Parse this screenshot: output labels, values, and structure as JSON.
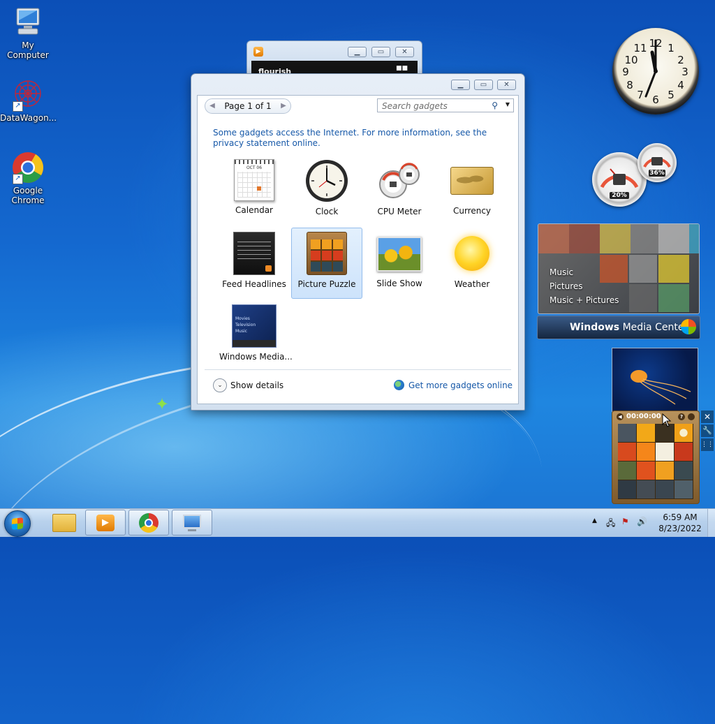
{
  "desktop": {
    "icons": [
      {
        "label": "My Computer",
        "icon": "computer-icon"
      },
      {
        "label": "DataWagon...",
        "icon": "datawagon-icon"
      },
      {
        "label": "Google Chrome",
        "icon": "chrome-icon"
      }
    ]
  },
  "flourish_window": {
    "title": "",
    "content_text": "flourish"
  },
  "gallery": {
    "pager_label": "Page 1 of 1",
    "search_placeholder": "Search gadgets",
    "info_text": "Some gadgets access the Internet.  For more information, see the privacy statement online.",
    "gadgets": [
      {
        "name": "Calendar",
        "icon": "calendar-icon"
      },
      {
        "name": "Clock",
        "icon": "clock-icon"
      },
      {
        "name": "CPU Meter",
        "icon": "cpu-meter-icon"
      },
      {
        "name": "Currency",
        "icon": "currency-icon"
      },
      {
        "name": "Feed Headlines",
        "icon": "feed-headlines-icon"
      },
      {
        "name": "Picture Puzzle",
        "icon": "picture-puzzle-icon",
        "selected": true
      },
      {
        "name": "Slide Show",
        "icon": "slide-show-icon"
      },
      {
        "name": "Weather",
        "icon": "weather-icon"
      },
      {
        "name": "Windows Media...",
        "icon": "windows-media-center-icon"
      }
    ],
    "calendar_thumb_month": "OCT 06",
    "wmc_thumb_items": [
      "Movies",
      "Television",
      "Music"
    ],
    "show_details_label": "Show details",
    "get_more_label": "Get more gadgets online"
  },
  "desktop_gadgets": {
    "cpu_meter": {
      "cpu_percent": "20%",
      "memory_percent": "36%"
    },
    "media_center": {
      "menu_items": [
        "Music",
        "Pictures",
        "Music + Pictures"
      ],
      "bar_title_bold": "Windows",
      "bar_title_rest": " Media Center"
    },
    "picture_puzzle": {
      "timer": "00:00:00"
    }
  },
  "taskbar": {
    "time": "6:59 AM",
    "date": "8/23/2022",
    "pinned": [
      "explorer-icon",
      "media-player-icon",
      "chrome-icon",
      "remote-desktop-icon"
    ]
  },
  "colors": {
    "link": "#1658a8",
    "selection": "#cde3fb"
  }
}
